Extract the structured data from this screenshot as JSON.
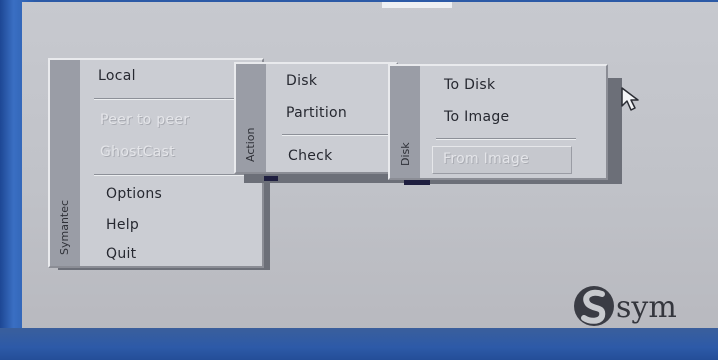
{
  "main_menu": {
    "side_label": "Symantec",
    "items": [
      {
        "label": "Local",
        "enabled": true
      },
      {
        "label": "Peer to peer",
        "enabled": false
      },
      {
        "label": "GhostCast",
        "enabled": false
      },
      {
        "label": "Options",
        "enabled": true
      },
      {
        "label": "Help",
        "enabled": true
      },
      {
        "label": "Quit",
        "enabled": true
      }
    ]
  },
  "action_menu": {
    "side_label": "Action",
    "items": [
      {
        "label": "Disk"
      },
      {
        "label": "Partition"
      },
      {
        "label": "Check"
      }
    ]
  },
  "disk_menu": {
    "side_label": "Disk",
    "items": [
      {
        "label": "To Disk"
      },
      {
        "label": "To Image"
      },
      {
        "label": "From Image",
        "highlighted": true
      }
    ]
  },
  "brand": {
    "logo_text": "sym",
    "logo_icon": "symantec-logo-icon"
  },
  "cursor": {
    "icon": "mouse-pointer-icon"
  },
  "colors": {
    "screen_bg": "#c0c2c8",
    "menu_bg": "#cbcdd3",
    "bezel": "#2c5aa6"
  }
}
